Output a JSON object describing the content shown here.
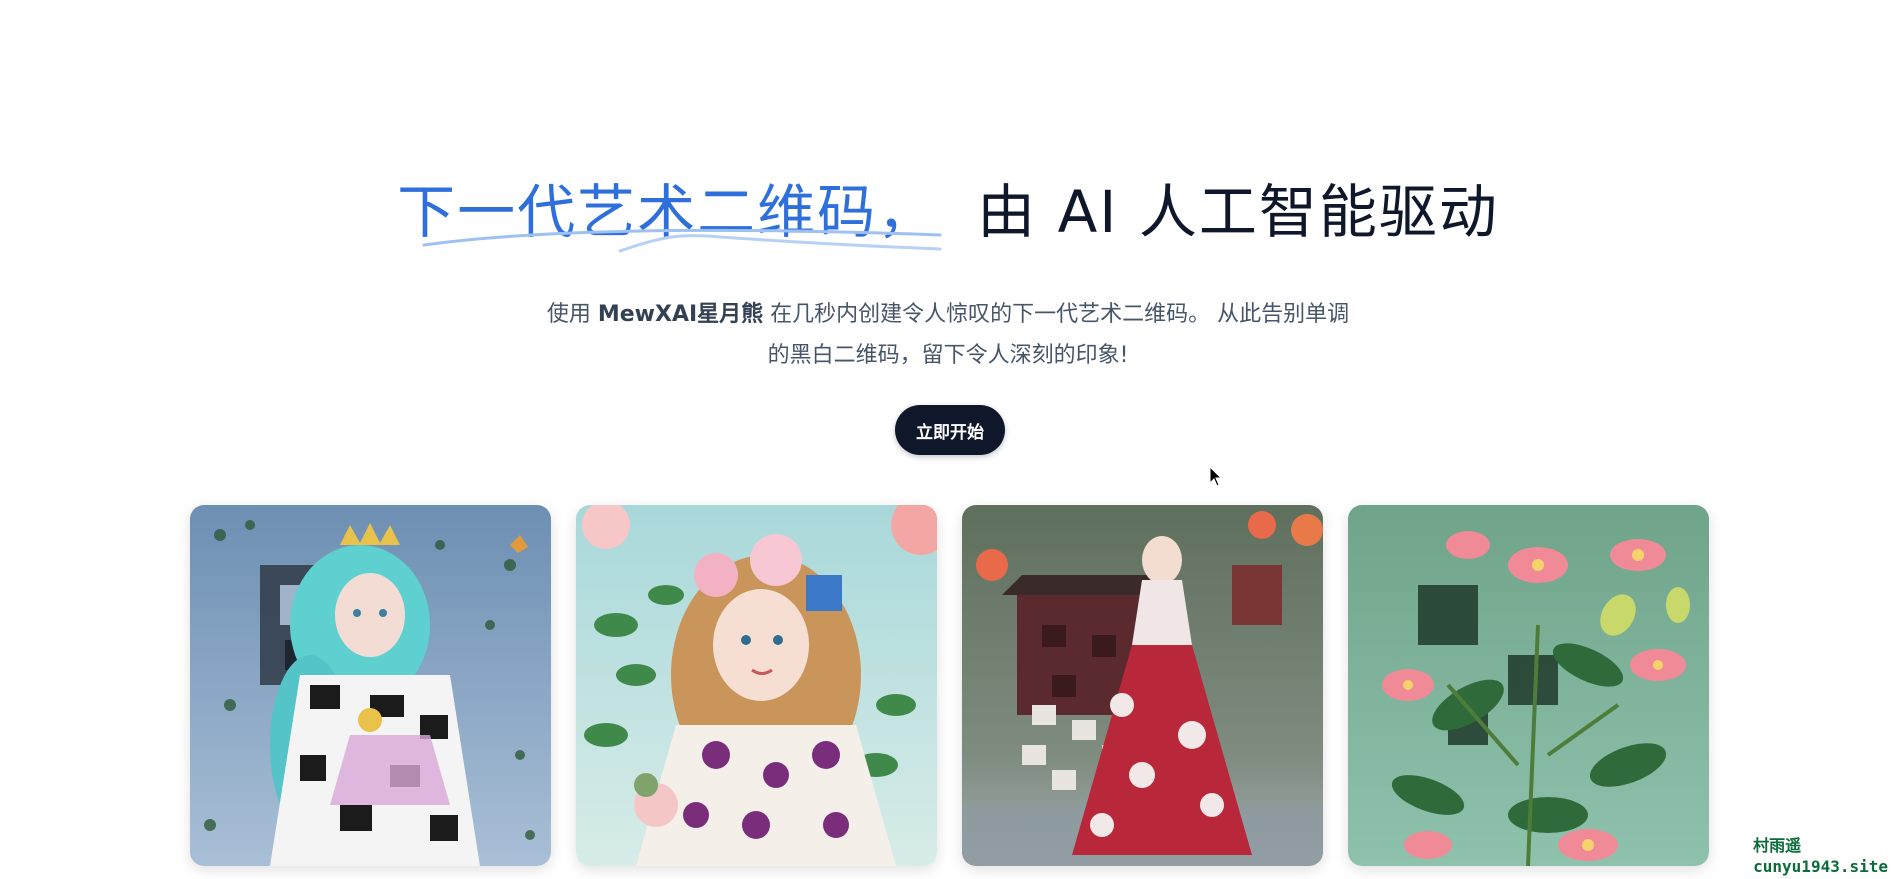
{
  "hero": {
    "title_accent": "下一代艺术二维码，",
    "title_rest": "由 AI 人工智能驱动",
    "desc_prefix": "使用 ",
    "desc_brand": "MewXAI星月熊",
    "desc_line1_rest": " 在几秒内创建令人惊叹的下一代艺术二维码。 从此告别单调",
    "desc_line2": "的黑白二维码，留下令人深刻的印象!",
    "cta_label": "立即开始"
  },
  "gallery": {
    "items": [
      {
        "subject": "teal-haired girl with butterflies"
      },
      {
        "subject": "blonde girl with flowers"
      },
      {
        "subject": "girl in red hanfu with lanterns"
      },
      {
        "subject": "pink lotus flowers"
      }
    ]
  },
  "watermark": {
    "line1": "村雨遥",
    "line2": "cunyu1943.site"
  },
  "colors": {
    "accent": "#2f6fdc",
    "text_dark": "#0f172a",
    "text_muted": "#475569",
    "button_bg": "#0f172a",
    "watermark": "#0b6b3a"
  }
}
